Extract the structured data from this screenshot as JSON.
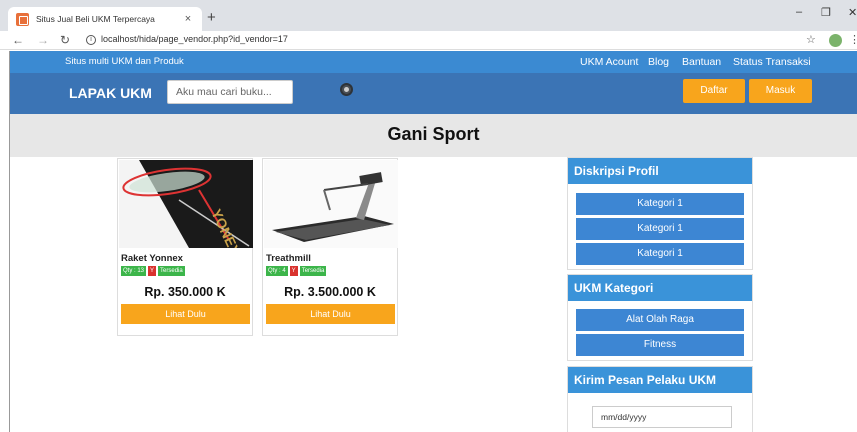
{
  "browser": {
    "tab_title": "Situs Jual Beli UKM Terpercaya",
    "tab_close": "×",
    "new_tab": "+",
    "url": "localhost/hida/page_vendor.php?id_vendor=17",
    "minimize": "–",
    "restore": "❐",
    "close": "✕"
  },
  "topbar": {
    "slogan": "Situs multi UKM dan Produk",
    "links": [
      "UKM Acount",
      "Blog",
      "Bantuan",
      "Status Transaksi"
    ]
  },
  "header": {
    "brand": "LAPAK UKM",
    "search_placeholder": "Aku mau cari buku...",
    "daftar": "Daftar",
    "masuk": "Masuk"
  },
  "page": {
    "title": "Gani Sport"
  },
  "products": [
    {
      "name": "Raket Yonnex",
      "qty": "Qty : 13",
      "flag": "Y",
      "stock": "Tersedia",
      "price": "Rp. 350.000 K",
      "button": "Lihat Dulu"
    },
    {
      "name": "Treathmill",
      "qty": "Qty : 4",
      "flag": "Y",
      "stock": "Tersedia",
      "price": "Rp. 3.500.000 K",
      "button": "Lihat Dulu"
    }
  ],
  "sidebar": {
    "profil": {
      "title": "Diskripsi Profil",
      "items": [
        "Kategori 1",
        "Kategori 1",
        "Kategori 1"
      ]
    },
    "kategori": {
      "title": "UKM Kategori",
      "items": [
        "Alat Olah Raga",
        "Fitness"
      ]
    },
    "pesan": {
      "title": "Kirim Pesan Pelaku UKM",
      "date_placeholder": "mm/dd/yyyy"
    }
  },
  "colors": {
    "topstrip": "#3b8ad2",
    "header": "#3b74b5",
    "accent_orange": "#f8a51c",
    "panel_head": "#3a93d9",
    "panel_item": "#3d86d3",
    "badge_green": "#3cb54a",
    "badge_red": "#d9322e"
  }
}
